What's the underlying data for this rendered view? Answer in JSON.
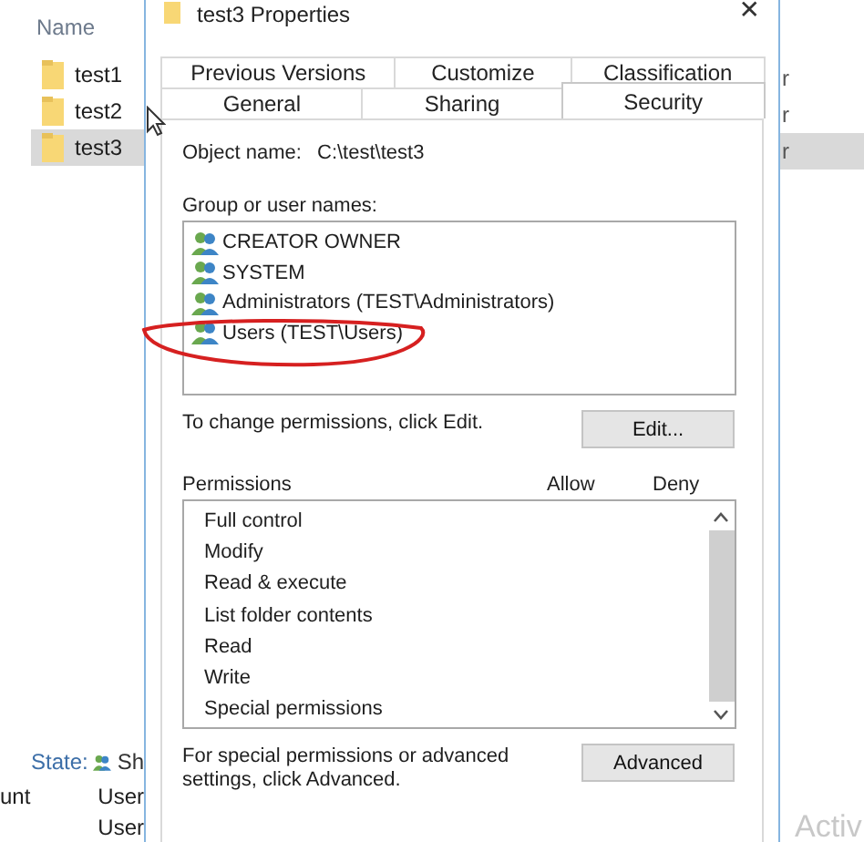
{
  "explorer": {
    "column_header": "Name",
    "items": [
      {
        "name": "test1",
        "selected": false,
        "column_2": "r"
      },
      {
        "name": "test2",
        "selected": false,
        "column_2": "r"
      },
      {
        "name": "test3",
        "selected": true,
        "column_2": "r"
      }
    ],
    "state_label": "State:",
    "state_value": "Sh",
    "bottom_rows": [
      {
        "column_1": "unt",
        "column_2": "User"
      },
      {
        "column_1": "",
        "column_2": "User"
      }
    ],
    "watermark_text": "Activ"
  },
  "window": {
    "title": "test3 Properties",
    "close": "✕"
  },
  "tabs": [
    [
      {
        "label": "Previous Versions",
        "selected": false
      },
      {
        "label": "Customize",
        "selected": false
      },
      {
        "label": "Classification",
        "selected": false
      }
    ],
    [
      {
        "label": "General",
        "selected": false
      },
      {
        "label": "Sharing",
        "selected": false
      },
      {
        "label": "Security",
        "selected": true
      }
    ]
  ],
  "object_name": {
    "label": "Object name:",
    "value": "C:\\test\\test3"
  },
  "groups": {
    "label": "Group or user names:",
    "items": [
      "CREATOR OWNER",
      "SYSTEM",
      "Administrators (TEST\\Administrators)",
      "Users (TEST\\Users)"
    ]
  },
  "edit_hint": "To change permissions, click Edit.",
  "edit_button": "Edit...",
  "permissions": {
    "label": "Permissions",
    "allow": "Allow",
    "deny": "Deny",
    "items": [
      "Full control",
      "Modify",
      "Read & execute",
      "List folder contents",
      "Read",
      "Write",
      "Special permissions"
    ]
  },
  "advanced_hint": "For special permissions or advanced settings, click Advanced.",
  "advanced_button": "Advanced"
}
